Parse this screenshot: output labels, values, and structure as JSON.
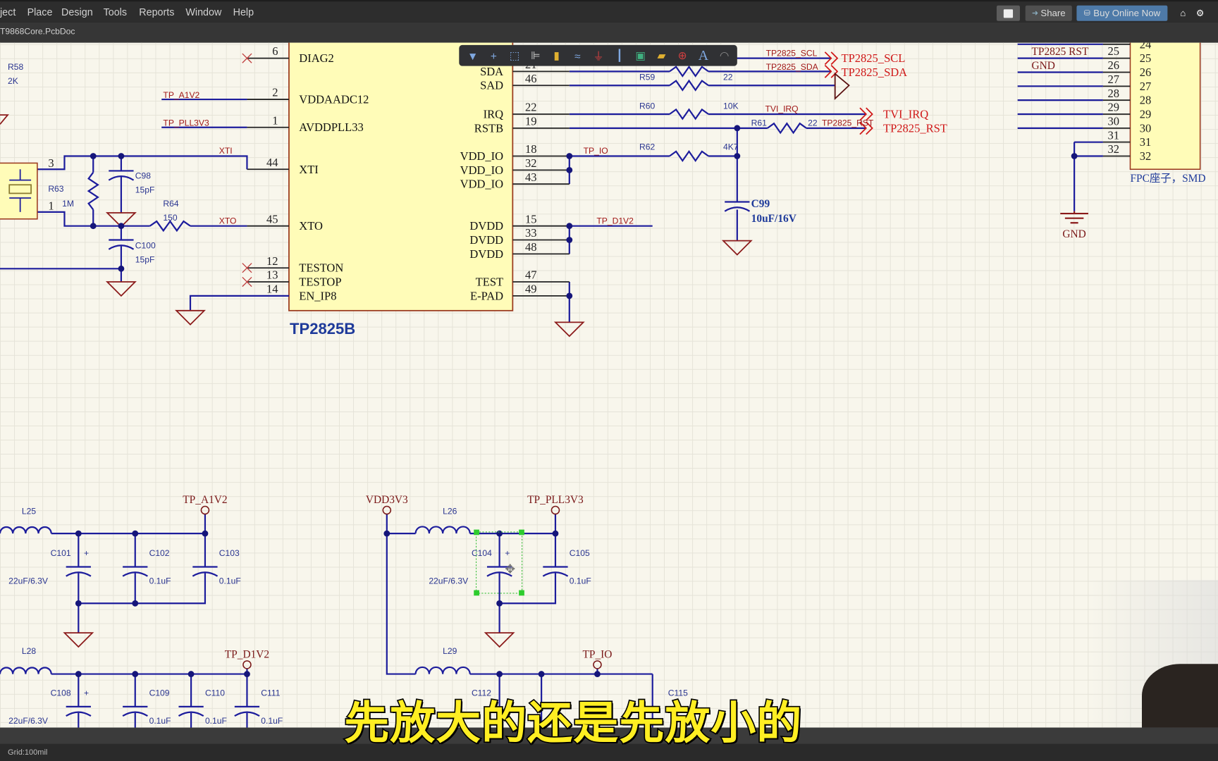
{
  "menu": [
    "ject",
    "Place",
    "Design",
    "Tools",
    "Reports",
    "Window",
    "Help"
  ],
  "doc_tab": "T9868Core.PcbDoc",
  "header_buttons": {
    "share": "Share",
    "buy": "Buy Online Now",
    "buy_color": "#4e7aa8"
  },
  "toolbar_icons": [
    "filter-icon",
    "cross-icon",
    "select-rect-icon",
    "align-icon",
    "component-icon",
    "harness-icon",
    "power-port-icon",
    "bus-icon",
    "sheet-symbol-icon",
    "port-icon",
    "no-erc-icon",
    "text-icon",
    "arc-icon"
  ],
  "chip": {
    "name": "TP2825B",
    "left_pins": [
      {
        "num": "6",
        "name": "DIAG2"
      },
      {
        "num": "2",
        "name": "VDDAADC12"
      },
      {
        "num": "1",
        "name": "AVDDPLL33"
      },
      {
        "num": "44",
        "name": "XTI"
      },
      {
        "num": "45",
        "name": "XTO"
      },
      {
        "num": "12",
        "name": "TESTON"
      },
      {
        "num": "13",
        "name": "TESTOP"
      },
      {
        "num": "14",
        "name": "EN_IP8"
      }
    ],
    "right_pins": [
      {
        "num": "21",
        "name": "SDA"
      },
      {
        "num": "46",
        "name": "SAD"
      },
      {
        "num": "22",
        "name": "IRQ"
      },
      {
        "num": "19",
        "name": "RSTB"
      },
      {
        "num": "18",
        "name": "VDD_IO"
      },
      {
        "num": "32",
        "name": "VDD_IO"
      },
      {
        "num": "43",
        "name": "VDD_IO"
      },
      {
        "num": "15",
        "name": "DVDD"
      },
      {
        "num": "33",
        "name": "DVDD"
      },
      {
        "num": "48",
        "name": "DVDD"
      },
      {
        "num": "47",
        "name": "TEST"
      },
      {
        "num": "49",
        "name": "E-PAD"
      }
    ]
  },
  "nets": {
    "tp_a1v2": "TP_A1V2",
    "tp_pll3v3": "TP_PLL3V3",
    "xti": "XTI",
    "xto": "XTO",
    "scl": "TP2825_SCL",
    "sda": "TP2825_SDA",
    "tvi_irq": "TVI_IRQ",
    "rst": "TP2825_RST",
    "tp_io": "TP_IO",
    "tp_d1v2": "TP_D1V2"
  },
  "ports": {
    "scl": "TP2825_SCL",
    "sda": "TP2825_SDA",
    "tvi_irq": "TVI_IRQ",
    "rst": "TP2825_RST"
  },
  "components": {
    "r58": {
      "ref": "R58",
      "val": "2K"
    },
    "r63": {
      "ref": "R63",
      "val": "1M"
    },
    "r64": {
      "ref": "R64",
      "val": "150"
    },
    "c98": {
      "ref": "C98",
      "val": "15pF"
    },
    "c100": {
      "ref": "C100",
      "val": "15pF"
    },
    "r59": {
      "ref": "R59",
      "val": "22"
    },
    "r60": {
      "ref": "R60",
      "val": "10K"
    },
    "r61": {
      "ref": "R61",
      "val": "22"
    },
    "r62": {
      "ref": "R62",
      "val": "4K7"
    },
    "c99": {
      "ref": "C99",
      "val": "10uF/16V"
    },
    "l25": "L25",
    "l26": "L26",
    "l28": "L28",
    "l29": "L29",
    "c101": {
      "ref": "C101",
      "val": "22uF/6.3V"
    },
    "c102": {
      "ref": "C102",
      "val": "0.1uF"
    },
    "c103": {
      "ref": "C103",
      "val": "0.1uF"
    },
    "c104": {
      "ref": "C104",
      "val": "22uF/6.3V"
    },
    "c105": {
      "ref": "C105",
      "val": "0.1uF"
    },
    "c108": {
      "ref": "C108",
      "val": "22uF/6.3V"
    },
    "c109": {
      "ref": "C109",
      "val": "0.1uF"
    },
    "c110": {
      "ref": "C110",
      "val": "0.1uF"
    },
    "c111": {
      "ref": "C111",
      "val": "0.1uF"
    },
    "c112": "C112",
    "c115": "C115",
    "polarity": "+"
  },
  "crystal_pins": {
    "p3": "3",
    "p1": "1"
  },
  "power": {
    "tp_a1v2": "TP_A1V2",
    "vdd3v3": "VDD3V3",
    "tp_pll3v3": "TP_PLL3V3",
    "tp_d1v2": "TP_D1V2",
    "tp_io": "TP_IO",
    "gnd": "GND"
  },
  "fpc": {
    "title": "FPC座子，SMD",
    "inner": [
      "24",
      "25",
      "26",
      "27",
      "28",
      "29",
      "30",
      "31",
      "32"
    ],
    "outer": [
      "25",
      "26",
      "27",
      "28",
      "29",
      "30",
      "31",
      "32"
    ],
    "net_rst": "TP2825 RST",
    "net_gnd": "GND"
  },
  "caption": "先放大的还是先放小的",
  "status": {
    "grid": "Grid:100mil"
  }
}
